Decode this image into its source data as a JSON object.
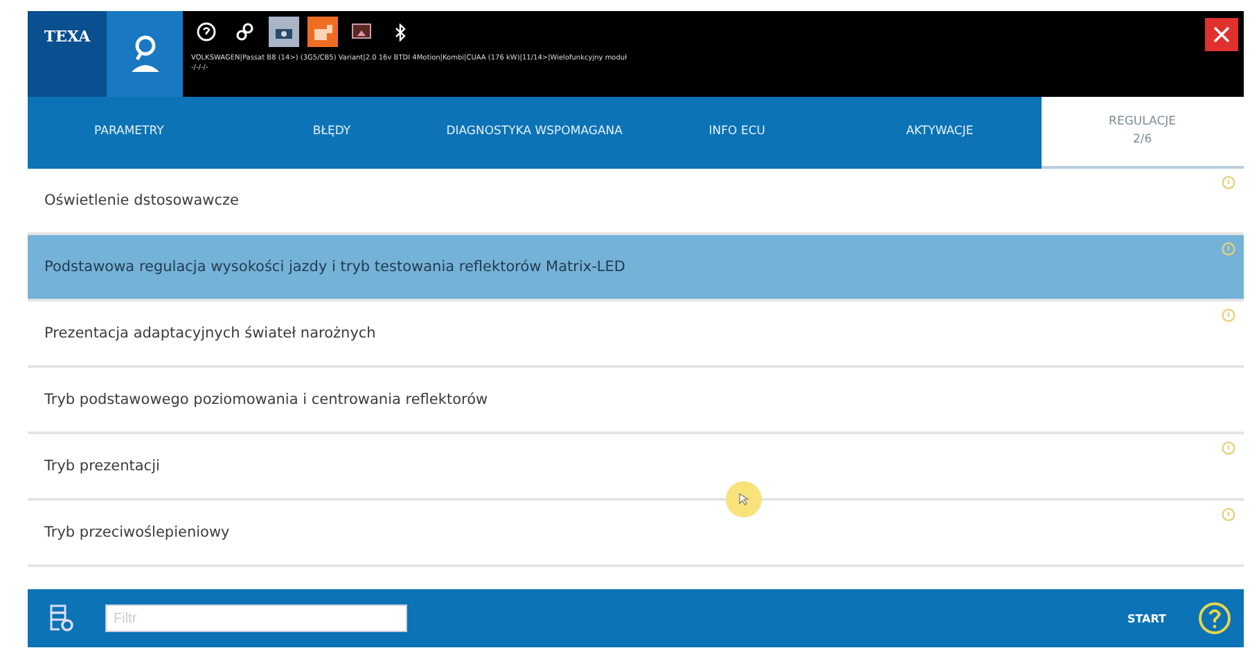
{
  "header": {
    "logo": "TEXA",
    "vehicle": "VOLKSWAGEN|Passat B8 (14>) (3G5/CB5) Variant|2.0 16v BTDI 4Motion|Kombi|CUAA (176 kW)|11/14>|Wielofunkcyjny moduł",
    "vehicle_line_2": "-/-/-/-"
  },
  "tabs": [
    {
      "label": "PARAMETRY",
      "selected": false
    },
    {
      "label": "BŁĘDY",
      "selected": false
    },
    {
      "label": "DIAGNOSTYKA WSPOMAGANA",
      "selected": false
    },
    {
      "label": "INFO ECU",
      "selected": false
    },
    {
      "label": "AKTYWACJE",
      "selected": false
    },
    {
      "label": "REGULACJE",
      "counter": "2/6",
      "selected": true
    }
  ],
  "items": [
    {
      "label": "Oświetlenie dstosowawcze",
      "selected": false,
      "info": true
    },
    {
      "label": "Podstawowa regulacja wysokości jazdy i tryb testowania reflektorów Matrix-LED",
      "selected": true,
      "info": true
    },
    {
      "label": "Prezentacja adaptacyjnych świateł narożnych",
      "selected": false,
      "info": true
    },
    {
      "label": "Tryb podstawowego poziomowania i centrowania reflektorów",
      "selected": false,
      "info": false
    },
    {
      "label": "Tryb prezentacji",
      "selected": false,
      "info": true
    },
    {
      "label": "Tryb przeciwoślepieniowy",
      "selected": false,
      "info": true
    }
  ],
  "footer": {
    "filter": {
      "placeholder": "Filtr"
    },
    "start": "START"
  }
}
